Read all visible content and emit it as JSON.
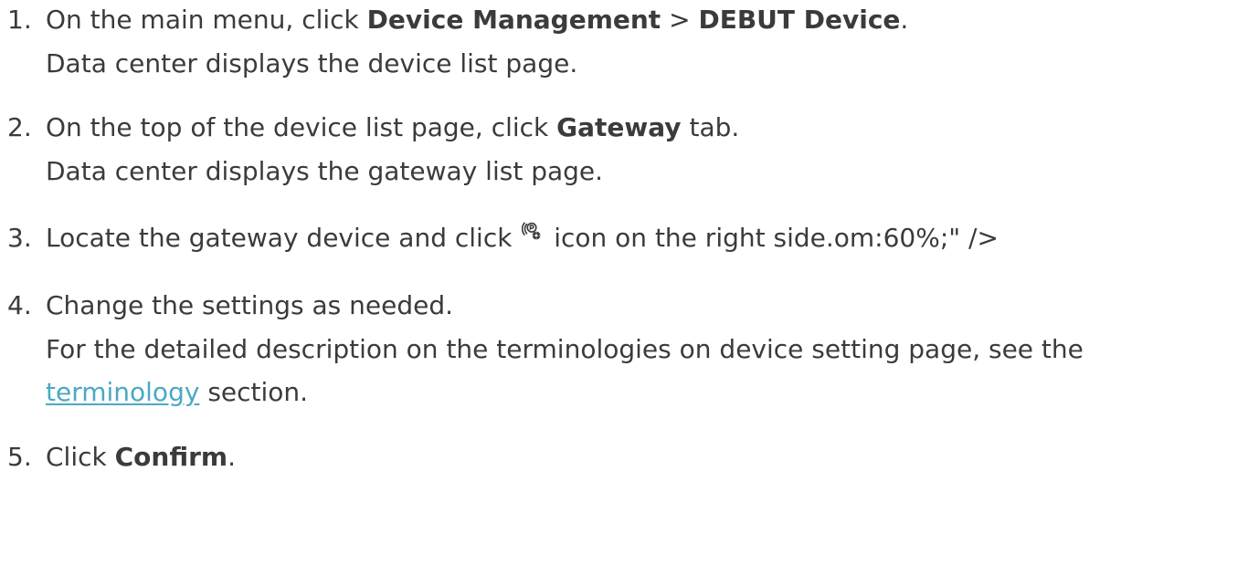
{
  "steps": [
    {
      "num": "1.",
      "text_a": "On the main menu, click ",
      "bold_a": "Device Management",
      "text_b": " > ",
      "bold_b": "DEBUT Device",
      "text_c": ".",
      "sub": "Data center displays the device list page."
    },
    {
      "num": "2.",
      "text_a": "On the top of the device list page, click ",
      "bold_a": "Gateway",
      "text_b": " tab.",
      "sub": "Data center displays the gateway list page."
    },
    {
      "num": "3.",
      "text_a": "Locate the gateway device and click ",
      "icon": "gateway-settings-icon",
      "text_b": " icon on the right side.om:60%;\" />"
    },
    {
      "num": "4.",
      "text_a": "Change the settings as needed.",
      "sub_a": "For the detailed description on the terminologies on device setting page, see the",
      "link": "terminology",
      "sub_b": " section."
    },
    {
      "num": "5.",
      "text_a": "Click ",
      "bold_a": "Confirm",
      "text_b": "."
    }
  ],
  "colors": {
    "text": "#3b3b3b",
    "link": "#4aa9c4"
  }
}
